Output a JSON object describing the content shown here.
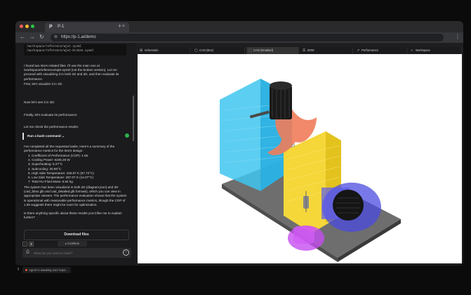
{
  "browser": {
    "tab_title": "P-1",
    "tab_icon": "P",
    "url": "https://p-1.ai/demo",
    "colors": {
      "close": "#ff5f57",
      "minimize": "#febc2e",
      "maximize": "#28c840"
    }
  },
  "chat": {
    "code_lines": [
      "/workspace/reference/wjet.sysml",
      "/workspace/reference/wjet-broken.sysml"
    ],
    "messages": [
      "I found two WJAI related files. I'll use the main one at /workspace/reference/wjet.sysml (not the broken version). Let me proceed with visualizing it in both 2D and 3D, and then evaluate its performance.",
      "First, let's visualize it in 2D:",
      "Now let's see it in 3D:",
      "Finally, let's evaluate its performance:",
      "Let me check the performance results:"
    ],
    "bash_label": "Run a bash command",
    "summary_intro": "I've completed all the requested tasks. Here's a summary of the performance metrics for the WJAI design:",
    "metrics": [
      "1. Coefficient of Performance (COP): 1.55",
      "2. Cooling Power: 6235.25 W",
      "3. Superheating: 6.27°C",
      "4. Subcooling: 30.98°C",
      "5. High Side Temperature: 349.87 K (67.72°C)",
      "6. Low Side Temperature: 287.07 K (14.07°C)",
      "7. Total HU Fluid Mass: 6.84 kg"
    ],
    "summary_outro": "The system has been visualized in both 2D (diagram.json) and 3D (cad_bbox.glb and cad_detailed.glb formats), which you can view in appropriate viewers. The performance evaluation shows that the system is operational with reasonable performance metrics, though the COP of 1.55 suggests there might be room for optimization.",
    "question": "Is there anything specific about these results you'd like me to explain further?",
    "download_label": "Download files",
    "continue_label": "Continue",
    "input_placeholder": "What do you want to build?"
  },
  "viewer": {
    "tabs": [
      {
        "label": "Schematic",
        "icon": "schematic-icon"
      },
      {
        "label": "CAD (Box)",
        "icon": "box-icon"
      },
      {
        "label": "CAD (Detailed)",
        "icon": "cube-icon"
      },
      {
        "label": "BOM",
        "icon": "list-icon"
      },
      {
        "label": "Performance",
        "icon": "chart-icon"
      },
      {
        "label": "Workspace",
        "icon": "code-icon"
      }
    ],
    "active_tab": "CAD (Detailed)"
  },
  "status": {
    "text": "Agent is awaiting user input..."
  }
}
